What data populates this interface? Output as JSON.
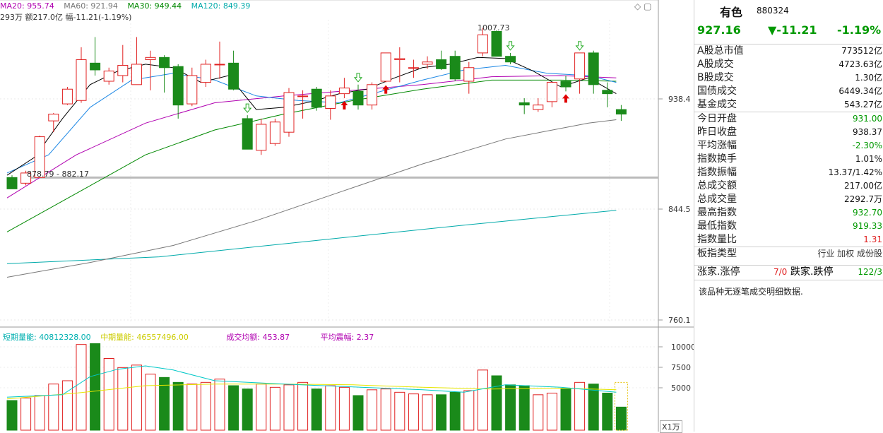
{
  "legend": {
    "ma20": "MA20: 955.74",
    "ma60": "MA60: 921.94",
    "ma30": "MA30: 949.44",
    "ma120": "MA120: 849.39",
    "stat": "293万 额217.0亿 幅-11.21(-1.19%)"
  },
  "vol_legend": {
    "short": "短期量能: 40812328.00",
    "mid": "中期量能: 46557496.00",
    "avg_amount": "成交均额: 453.87",
    "avg_amp": "平均震幅: 2.37"
  },
  "annotations": {
    "high": "1007.73",
    "range": "878.79 - 882.17"
  },
  "axis": {
    "price_ticks": [
      "938.4",
      "844.5",
      "760.1"
    ],
    "vol_ticks": [
      "10000",
      "7500",
      "5000"
    ],
    "vol_unit": "X1万"
  },
  "colors": {
    "up": "#e02020",
    "down": "#1a8a1a",
    "ma5": "#000000",
    "ma10": "#1e88e5",
    "ma20": "#b000b0",
    "ma30": "#008800",
    "ma60": "#777777",
    "ma120": "#00aaaa",
    "vol_short": "#00c8c8",
    "vol_mid": "#e6e600"
  },
  "chart_data": {
    "type": "candlestick",
    "y_range": [
      751,
      1016
    ],
    "volume_range": [
      0,
      10800
    ],
    "volume_unit": "万",
    "candles": [
      {
        "o": 878,
        "h": 880,
        "l": 868,
        "c": 868,
        "v": 3600
      },
      {
        "o": 873,
        "h": 884,
        "l": 871,
        "c": 882,
        "v": 3900
      },
      {
        "o": 878,
        "h": 915,
        "l": 878,
        "c": 914,
        "v": 4200
      },
      {
        "o": 928,
        "h": 935,
        "l": 918,
        "c": 934,
        "v": 5600
      },
      {
        "o": 943,
        "h": 958,
        "l": 942,
        "c": 956,
        "v": 6000
      },
      {
        "o": 946,
        "h": 993,
        "l": 944,
        "c": 982,
        "v": 10400
      },
      {
        "o": 979,
        "h": 1002,
        "l": 968,
        "c": 973,
        "v": 10500
      },
      {
        "o": 963,
        "h": 975,
        "l": 960,
        "c": 972,
        "v": 8700
      },
      {
        "o": 968,
        "h": 995,
        "l": 962,
        "c": 977,
        "v": 7600
      },
      {
        "o": 960,
        "h": 1002,
        "l": 960,
        "c": 978,
        "v": 7900
      },
      {
        "o": 982,
        "h": 990,
        "l": 955,
        "c": 984,
        "v": 6800
      },
      {
        "o": 984,
        "h": 986,
        "l": 953,
        "c": 975,
        "v": 6400
      },
      {
        "o": 976,
        "h": 978,
        "l": 930,
        "c": 942,
        "v": 5800
      },
      {
        "o": 943,
        "h": 975,
        "l": 941,
        "c": 968,
        "v": 5600
      },
      {
        "o": 962,
        "h": 982,
        "l": 958,
        "c": 978,
        "v": 5800
      },
      {
        "o": 978,
        "h": 998,
        "l": 965,
        "c": 978,
        "v": 6200
      },
      {
        "o": 979,
        "h": 990,
        "l": 955,
        "c": 956,
        "v": 5400
      },
      {
        "o": 930,
        "h": 933,
        "l": 903,
        "c": 903,
        "v": 5000
      },
      {
        "o": 902,
        "h": 930,
        "l": 898,
        "c": 925,
        "v": 5600
      },
      {
        "o": 908,
        "h": 930,
        "l": 906,
        "c": 927,
        "v": 5200
      },
      {
        "o": 918,
        "h": 957,
        "l": 914,
        "c": 953,
        "v": 5500
      },
      {
        "o": 950,
        "h": 955,
        "l": 930,
        "c": 950,
        "v": 5800
      },
      {
        "o": 956,
        "h": 958,
        "l": 937,
        "c": 940,
        "v": 5000
      },
      {
        "o": 939,
        "h": 955,
        "l": 929,
        "c": 950,
        "v": 5400
      },
      {
        "o": 952,
        "h": 966,
        "l": 948,
        "c": 957,
        "v": 5200
      },
      {
        "o": 954,
        "h": 960,
        "l": 938,
        "c": 942,
        "v": 4200
      },
      {
        "o": 942,
        "h": 962,
        "l": 938,
        "c": 960,
        "v": 4900
      },
      {
        "o": 963,
        "h": 988,
        "l": 962,
        "c": 988,
        "v": 5000
      },
      {
        "o": 982,
        "h": 993,
        "l": 962,
        "c": 983,
        "v": 4600
      },
      {
        "o": 975,
        "h": 982,
        "l": 966,
        "c": 975,
        "v": 4400
      },
      {
        "o": 978,
        "h": 985,
        "l": 974,
        "c": 980,
        "v": 4300
      },
      {
        "o": 982,
        "h": 990,
        "l": 973,
        "c": 974,
        "v": 4300
      },
      {
        "o": 985,
        "h": 990,
        "l": 963,
        "c": 965,
        "v": 4600
      },
      {
        "o": 963,
        "h": 980,
        "l": 952,
        "c": 975,
        "v": 4800
      },
      {
        "o": 988,
        "h": 1010,
        "l": 985,
        "c": 1004,
        "v": 7300
      },
      {
        "o": 1007,
        "h": 1008,
        "l": 985,
        "c": 985,
        "v": 6600
      },
      {
        "o": 985,
        "h": 988,
        "l": 978,
        "c": 980,
        "v": 5500
      },
      {
        "o": 944,
        "h": 948,
        "l": 934,
        "c": 942,
        "v": 5400
      },
      {
        "o": 938,
        "h": 948,
        "l": 936,
        "c": 942,
        "v": 4300
      },
      {
        "o": 945,
        "h": 962,
        "l": 940,
        "c": 962,
        "v": 4500
      },
      {
        "o": 963,
        "h": 968,
        "l": 954,
        "c": 958,
        "v": 5000
      },
      {
        "o": 965,
        "h": 988,
        "l": 952,
        "c": 988,
        "v": 5800
      },
      {
        "o": 988,
        "h": 990,
        "l": 952,
        "c": 960,
        "v": 5600
      },
      {
        "o": 955,
        "h": 962,
        "l": 940,
        "c": 952,
        "v": 4500
      },
      {
        "o": 938,
        "h": 942,
        "l": 928,
        "c": 934,
        "v": 2800
      }
    ],
    "ma5": [
      {
        "i": 0,
        "y": 880
      },
      {
        "i": 2,
        "y": 896
      },
      {
        "i": 4,
        "y": 930
      },
      {
        "i": 6,
        "y": 960
      },
      {
        "i": 8,
        "y": 972
      },
      {
        "i": 10,
        "y": 978
      },
      {
        "i": 12,
        "y": 975
      },
      {
        "i": 14,
        "y": 962
      },
      {
        "i": 16,
        "y": 968
      },
      {
        "i": 18,
        "y": 938
      },
      {
        "i": 20,
        "y": 940
      },
      {
        "i": 22,
        "y": 945
      },
      {
        "i": 24,
        "y": 952
      },
      {
        "i": 26,
        "y": 956
      },
      {
        "i": 28,
        "y": 966
      },
      {
        "i": 30,
        "y": 975
      },
      {
        "i": 32,
        "y": 978
      },
      {
        "i": 34,
        "y": 984
      },
      {
        "i": 36,
        "y": 983
      },
      {
        "i": 38,
        "y": 972
      },
      {
        "i": 40,
        "y": 958
      },
      {
        "i": 42,
        "y": 966
      },
      {
        "i": 44,
        "y": 952
      }
    ],
    "ma10": [
      {
        "i": 0,
        "y": 882
      },
      {
        "i": 3,
        "y": 898
      },
      {
        "i": 6,
        "y": 940
      },
      {
        "i": 9,
        "y": 964
      },
      {
        "i": 12,
        "y": 970
      },
      {
        "i": 15,
        "y": 964
      },
      {
        "i": 18,
        "y": 950
      },
      {
        "i": 21,
        "y": 946
      },
      {
        "i": 24,
        "y": 944
      },
      {
        "i": 27,
        "y": 954
      },
      {
        "i": 30,
        "y": 964
      },
      {
        "i": 33,
        "y": 973
      },
      {
        "i": 36,
        "y": 977
      },
      {
        "i": 39,
        "y": 970
      },
      {
        "i": 42,
        "y": 968
      },
      {
        "i": 44,
        "y": 962
      }
    ],
    "ma20": [
      {
        "i": 0,
        "y": 860
      },
      {
        "i": 5,
        "y": 898
      },
      {
        "i": 10,
        "y": 926
      },
      {
        "i": 15,
        "y": 944
      },
      {
        "i": 20,
        "y": 950
      },
      {
        "i": 25,
        "y": 955
      },
      {
        "i": 30,
        "y": 960
      },
      {
        "i": 35,
        "y": 967
      },
      {
        "i": 40,
        "y": 968
      },
      {
        "i": 44,
        "y": 966
      }
    ],
    "ma30": [
      {
        "i": 0,
        "y": 830
      },
      {
        "i": 5,
        "y": 864
      },
      {
        "i": 10,
        "y": 898
      },
      {
        "i": 15,
        "y": 920
      },
      {
        "i": 20,
        "y": 934
      },
      {
        "i": 25,
        "y": 946
      },
      {
        "i": 30,
        "y": 956
      },
      {
        "i": 35,
        "y": 964
      },
      {
        "i": 40,
        "y": 964
      },
      {
        "i": 44,
        "y": 963
      }
    ],
    "ma60": [
      {
        "i": 0,
        "y": 790
      },
      {
        "i": 6,
        "y": 803
      },
      {
        "i": 12,
        "y": 818
      },
      {
        "i": 18,
        "y": 840
      },
      {
        "i": 24,
        "y": 865
      },
      {
        "i": 30,
        "y": 890
      },
      {
        "i": 36,
        "y": 912
      },
      {
        "i": 42,
        "y": 926
      },
      {
        "i": 44,
        "y": 929
      }
    ],
    "ma120": [
      {
        "i": 0,
        "y": 802
      },
      {
        "i": 11,
        "y": 808
      },
      {
        "i": 22,
        "y": 822
      },
      {
        "i": 33,
        "y": 836
      },
      {
        "i": 44,
        "y": 849
      }
    ],
    "vol_short": [
      {
        "i": 0,
        "y": 4000
      },
      {
        "i": 4,
        "y": 4300
      },
      {
        "i": 6,
        "y": 6500
      },
      {
        "i": 8,
        "y": 7400
      },
      {
        "i": 10,
        "y": 7800
      },
      {
        "i": 12,
        "y": 7300
      },
      {
        "i": 15,
        "y": 6000
      },
      {
        "i": 20,
        "y": 5600
      },
      {
        "i": 30,
        "y": 4900
      },
      {
        "i": 33,
        "y": 4600
      },
      {
        "i": 36,
        "y": 5500
      },
      {
        "i": 40,
        "y": 5200
      },
      {
        "i": 44,
        "y": 4600
      }
    ],
    "vol_mid": [
      {
        "i": 0,
        "y": 3800
      },
      {
        "i": 5,
        "y": 4500
      },
      {
        "i": 10,
        "y": 5400
      },
      {
        "i": 15,
        "y": 5600
      },
      {
        "i": 20,
        "y": 5600
      },
      {
        "i": 25,
        "y": 5500
      },
      {
        "i": 30,
        "y": 5200
      },
      {
        "i": 35,
        "y": 5000
      },
      {
        "i": 40,
        "y": 5100
      },
      {
        "i": 44,
        "y": 4900
      }
    ],
    "support_line": 878,
    "up_arrows": [
      24,
      27,
      40
    ],
    "down_arrows": [
      17,
      25,
      36,
      41
    ]
  },
  "panel": {
    "name": "有色",
    "code": "880324",
    "price": "927.16",
    "change": "▼-11.21",
    "pct": "-1.19%",
    "rows": [
      {
        "k": "A股总市值",
        "v": "773512亿",
        "c": "#111111"
      },
      {
        "k": "A股成交",
        "v": "4723.63亿",
        "c": "#111111"
      },
      {
        "k": "B股成交",
        "v": "1.30亿",
        "c": "#111111"
      },
      {
        "k": "国债成交",
        "v": "6449.34亿",
        "c": "#111111"
      },
      {
        "k": "基金成交",
        "v": "543.27亿",
        "c": "#111111"
      },
      {
        "k": "今日开盘",
        "v": "931.00",
        "c": "#009900"
      },
      {
        "k": "昨日收盘",
        "v": "938.37",
        "c": "#111111"
      },
      {
        "k": "平均涨幅",
        "v": "-2.30%",
        "c": "#009900"
      },
      {
        "k": "指数换手",
        "v": "1.01%",
        "c": "#111111"
      },
      {
        "k": "指数振幅",
        "v": "13.37/1.42%",
        "c": "#111111"
      },
      {
        "k": "总成交额",
        "v": "217.00亿",
        "c": "#111111"
      },
      {
        "k": "总成交量",
        "v": "2292.7万",
        "c": "#111111"
      },
      {
        "k": "最高指数",
        "v": "932.70",
        "c": "#009900"
      },
      {
        "k": "最低指数",
        "v": "919.33",
        "c": "#009900"
      },
      {
        "k": "指数量比",
        "v": "1.31",
        "c": "#e02020"
      },
      {
        "k": "板指类型",
        "v": "行业 加权 成份股",
        "c": "#333333"
      }
    ],
    "limit_row": {
      "k1": "涨家.涨停",
      "v1": "7/0",
      "k2": "跌家.跌停",
      "v2": "122/3"
    },
    "note": "该品种无逐笔成交明细数据."
  }
}
